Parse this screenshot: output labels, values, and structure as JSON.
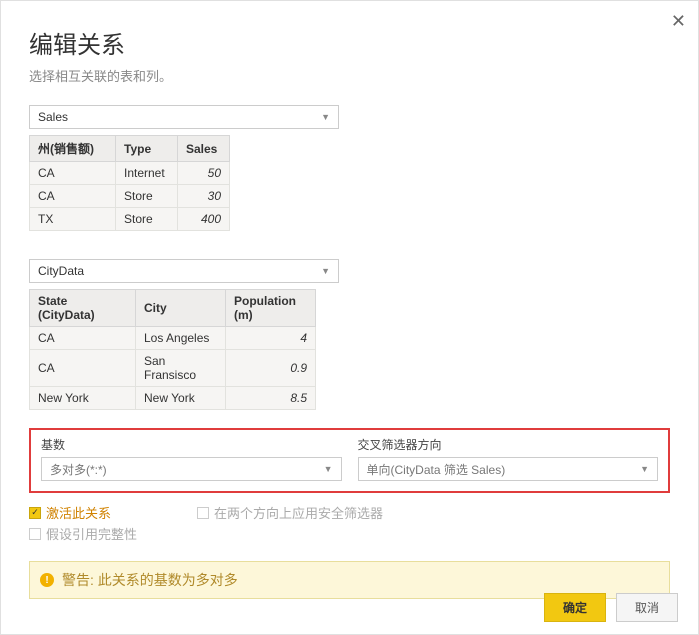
{
  "close": "✕",
  "title": "编辑关系",
  "subtitle": "选择相互关联的表和列。",
  "table1": {
    "name": "Sales",
    "headers": [
      "州(销售额)",
      "Type",
      "Sales"
    ],
    "rows": [
      [
        "CA",
        "Internet",
        "50"
      ],
      [
        "CA",
        "Store",
        "30"
      ],
      [
        "TX",
        "Store",
        "400"
      ]
    ]
  },
  "table2": {
    "name": "CityData",
    "headers": [
      "State (CityData)",
      "City",
      "Population (m)"
    ],
    "rows": [
      [
        "CA",
        "Los Angeles",
        "4"
      ],
      [
        "CA",
        "San Fransisco",
        "0.9"
      ],
      [
        "New York",
        "New York",
        "8.5"
      ]
    ]
  },
  "cardinality": {
    "label": "基数",
    "value": "多对多(*:*)"
  },
  "crossfilter": {
    "label": "交叉筛选器方向",
    "value": "单向(CityData 筛选 Sales)"
  },
  "checks": {
    "activate": "激活此关系",
    "assume": "假设引用完整性",
    "security": "在两个方向上应用安全筛选器"
  },
  "warning": "警告: 此关系的基数为多对多",
  "buttons": {
    "ok": "确定",
    "cancel": "取消"
  }
}
